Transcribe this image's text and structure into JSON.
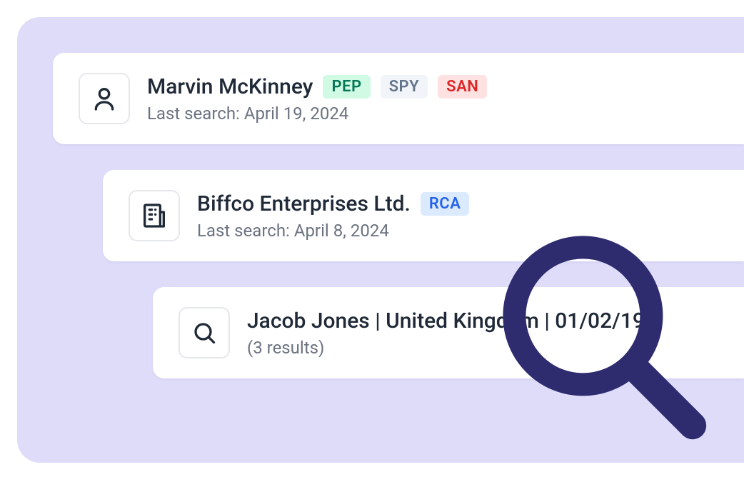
{
  "cards": [
    {
      "icon": "person",
      "title": "Marvin McKinney",
      "subtitle": "Last search: April 19, 2024",
      "badges": [
        {
          "text": "PEP",
          "type": "pep"
        },
        {
          "text": "SPY",
          "type": "spy"
        },
        {
          "text": "SAN",
          "type": "san"
        }
      ]
    },
    {
      "icon": "building",
      "title": "Biffco Enterprises Ltd.",
      "subtitle": "Last search: April 8, 2024",
      "badges": [
        {
          "text": "RCA",
          "type": "rca"
        }
      ]
    },
    {
      "icon": "search",
      "title": "Jacob Jones | United Kingdom | 01/02/196",
      "subtitle": "(3 results)",
      "badges": []
    }
  ],
  "colors": {
    "background": "#DEDCF9",
    "magnifier": "#2E2C6E"
  }
}
